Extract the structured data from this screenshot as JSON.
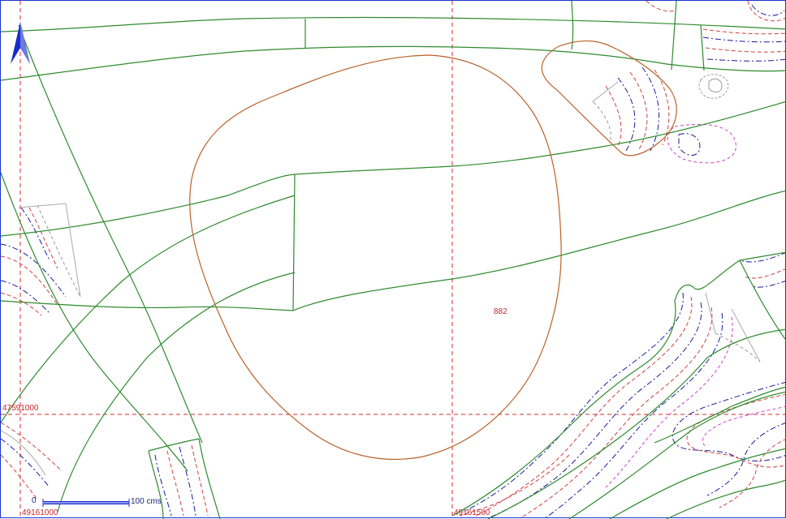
{
  "grid": {
    "easting_labels": [
      "49161000",
      "49161500"
    ],
    "northing_labels": [
      "47591000"
    ]
  },
  "parcel_label": "882",
  "scale_bar": {
    "start_label": "0",
    "end_label": "100  cms"
  },
  "colors": {
    "grid": "#d22b2b",
    "parcel_boundary": "#2e8b2e",
    "highlight_boundary": "#b8622a",
    "contour_blue": "#1a1aa0",
    "contour_red": "#d04040",
    "contour_pink": "#cc44cc",
    "frame": "#1a35c8",
    "north_arrow": "#1a2bd0"
  },
  "north_arrow_icon": "north-arrow-icon"
}
